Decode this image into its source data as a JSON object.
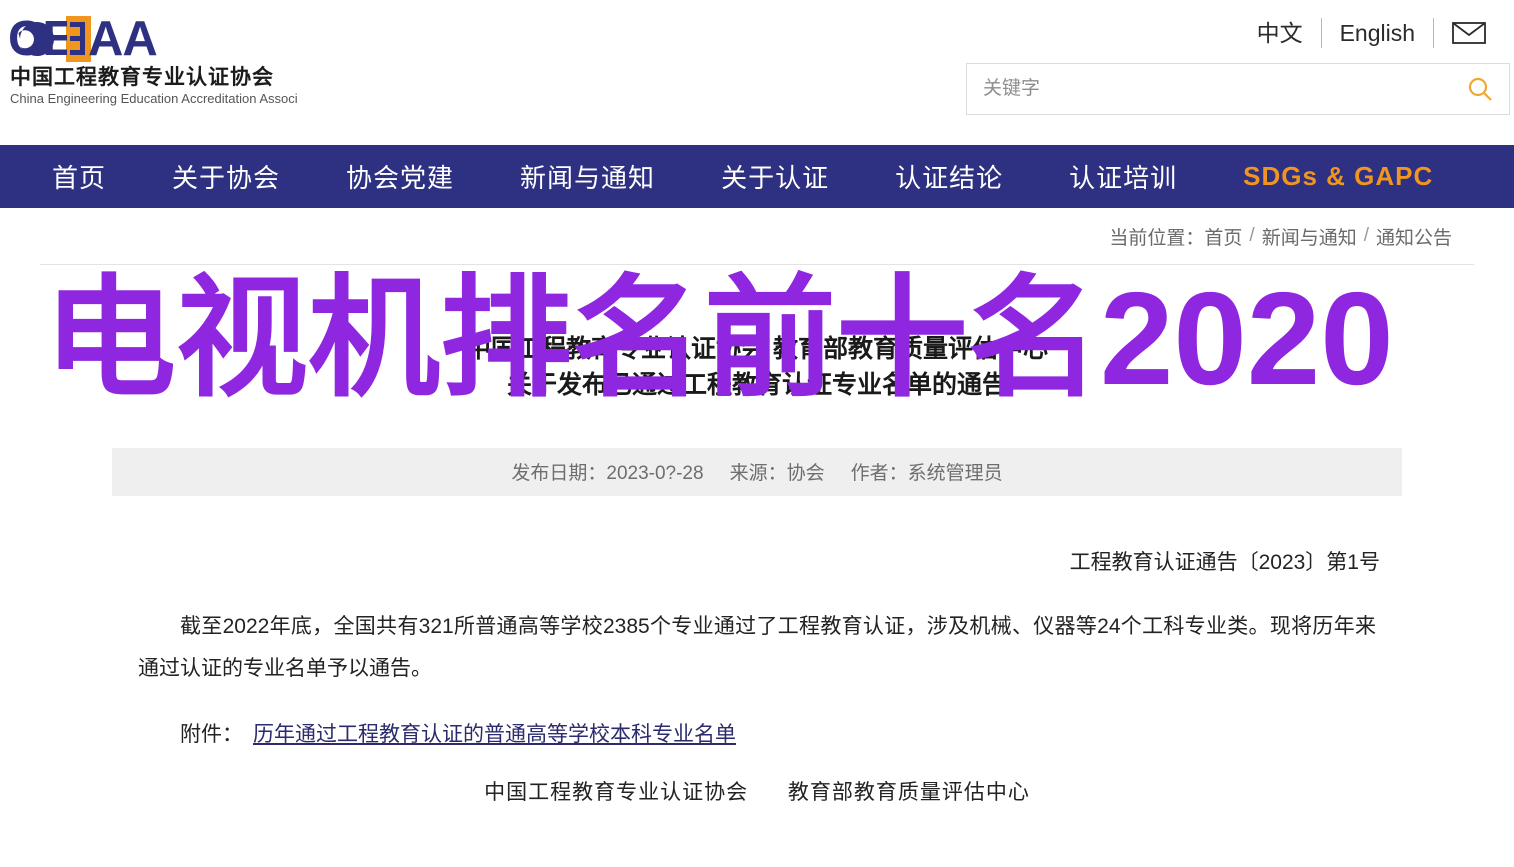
{
  "header": {
    "logo": {
      "mark_text": "CEEAA",
      "cn_name": "中国工程教育专业认证协会",
      "en_name": "China Engineering Education Accreditation Association",
      "colors": {
        "blue": "#2e3182",
        "orange": "#f0951e"
      }
    },
    "top_links": [
      {
        "label": "中文",
        "name": "lang-chinese"
      },
      {
        "label": "English",
        "name": "lang-english"
      }
    ],
    "mail_icon": "mail-icon",
    "search": {
      "placeholder": "关键字",
      "value": "",
      "icon": "search-icon",
      "icon_color": "#f0a832"
    }
  },
  "nav": {
    "background": "#2e3182",
    "items": [
      {
        "label": "首页",
        "name": "nav-home",
        "accent": false
      },
      {
        "label": "关于协会",
        "name": "nav-about-association",
        "accent": false
      },
      {
        "label": "协会党建",
        "name": "nav-party-building",
        "accent": false
      },
      {
        "label": "新闻与通知",
        "name": "nav-news-notice",
        "accent": false
      },
      {
        "label": "关于认证",
        "name": "nav-about-accreditation",
        "accent": false
      },
      {
        "label": "认证结论",
        "name": "nav-accreditation-results",
        "accent": false
      },
      {
        "label": "认证培训",
        "name": "nav-accreditation-training",
        "accent": false
      },
      {
        "label": "SDGs & GAPC",
        "name": "nav-sdgs-gapc",
        "accent": true
      }
    ]
  },
  "breadcrumb": {
    "prefix": "当前位置：",
    "items": [
      "首页",
      "新闻与通知",
      "通知公告"
    ],
    "separator": "/"
  },
  "article": {
    "title_line1": "中国工程教育专业认证协会 教育部教育质量评估中心",
    "title_line2": "关于发布已通过工程教育认证专业名单的通告",
    "meta": {
      "publish_date_label": "发布日期：2023-0?-28",
      "source_label": "来源：协会",
      "author_label": "作者：系统管理员"
    },
    "doc_number": "工程教育认证通告〔2023〕第1号",
    "paragraph": "截至2022年底，全国共有321所普通高等学校2385个专业通过了工程教育认证，涉及机械、仪器等24个工科专业类。现将历年来通过认证的专业名单予以通告。",
    "attachment_label": "附件：",
    "attachment_link": "历年通过工程教育认证的普通高等学校本科专业名单",
    "signature_left": "中国工程教育专业认证协会",
    "signature_right": "教育部教育质量评估中心"
  },
  "overlay": {
    "text": "电视机排名前十名2020",
    "color": "#8f26e0"
  }
}
